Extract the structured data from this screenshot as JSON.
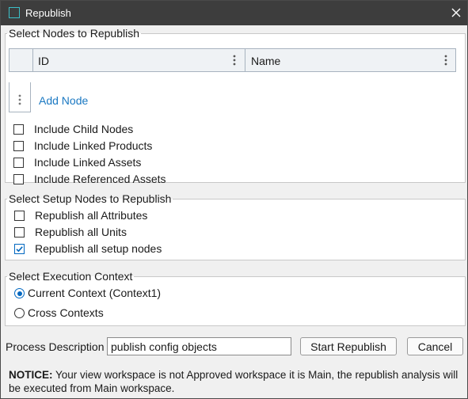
{
  "window": {
    "title": "Republish"
  },
  "nodes_section": {
    "legend": "Select Nodes to Republish",
    "grid": {
      "columns": [
        "ID",
        "Name"
      ],
      "add_link": "Add Node"
    },
    "options": [
      {
        "label": "Include Child Nodes",
        "checked": false
      },
      {
        "label": "Include Linked Products",
        "checked": false
      },
      {
        "label": "Include Linked Assets",
        "checked": false
      },
      {
        "label": "Include Referenced Assets",
        "checked": false
      }
    ]
  },
  "setup_section": {
    "legend": "Select Setup Nodes to Republish",
    "options": [
      {
        "label": "Republish all Attributes",
        "checked": false
      },
      {
        "label": "Republish all Units",
        "checked": false
      },
      {
        "label": "Republish all setup nodes",
        "checked": true
      }
    ]
  },
  "context_section": {
    "legend": "Select Execution Context",
    "options": [
      {
        "label": "Current Context (Context1)",
        "selected": true
      },
      {
        "label": "Cross Contexts",
        "selected": false
      }
    ]
  },
  "footer": {
    "description_label": "Process Description",
    "description_value": "publish config objects",
    "start_button": "Start Republish",
    "cancel_button": "Cancel"
  },
  "notice": {
    "prefix": "NOTICE:",
    "text": " Your view workspace is not Approved workspace it is Main, the republish analysis will be executed from Main workspace."
  },
  "colors": {
    "titlebar": "#3d3d3d",
    "accent": "#0067c0",
    "link": "#1a78c2",
    "title_icon": "#3cc0c8"
  }
}
